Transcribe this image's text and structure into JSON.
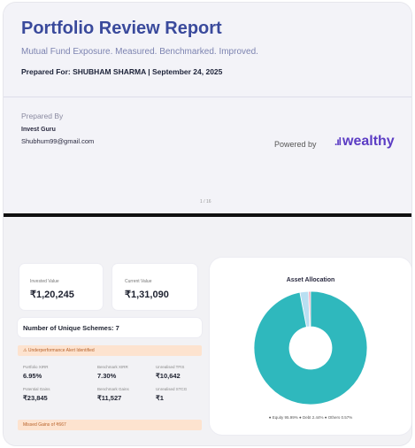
{
  "report": {
    "title": "Portfolio Review Report",
    "subtitle": "Mutual Fund Exposure. Measured. Benchmarked. Improved.",
    "prepared_for": "Prepared For: SHUBHAM SHARMA | September 24, 2025"
  },
  "prepared_by": {
    "label": "Prepared By",
    "org": "Invest Guru",
    "email": "Shubhum99@gmail.com"
  },
  "powered_by": {
    "label": "Powered by",
    "brand": "wealthy",
    "brand_mark": ".ıl"
  },
  "page_number": "1 / 16",
  "summary": {
    "invested_label": "Invested Value",
    "invested_value": "₹1,20,245",
    "current_label": "Current Value",
    "current_value": "₹1,31,090",
    "unique_schemes": "Number of Unique Schemes: 7",
    "banner": "⚠ Underperformance Alert Identified",
    "metrics": [
      {
        "label": "Portfolio XIRR",
        "value": "6.95%"
      },
      {
        "label": "Benchmark XIRR",
        "value": "7.30%"
      },
      {
        "label": "Unrealised TFIS",
        "value": "₹10,642"
      },
      {
        "label": "Potential Gains",
        "value": "₹23,845"
      },
      {
        "label": "Benchmark Gains",
        "value": "₹11,527"
      },
      {
        "label": "Unrealised STCG",
        "value": "₹1"
      }
    ],
    "bottom_banner": "Missed Gains of ₹667"
  },
  "allocation": {
    "title": "Asset Allocation",
    "legend": "● Equity 95.99% ● Debt 2.44% ● Others 0.57%",
    "colors": {
      "equity": "#2fb8bd",
      "debt": "#b9dff2",
      "others": "#f0a0b4"
    }
  },
  "chart_data": {
    "type": "pie",
    "title": "Asset Allocation",
    "categories": [
      "Equity",
      "Debt",
      "Others"
    ],
    "values": [
      95.99,
      2.44,
      0.57
    ]
  }
}
